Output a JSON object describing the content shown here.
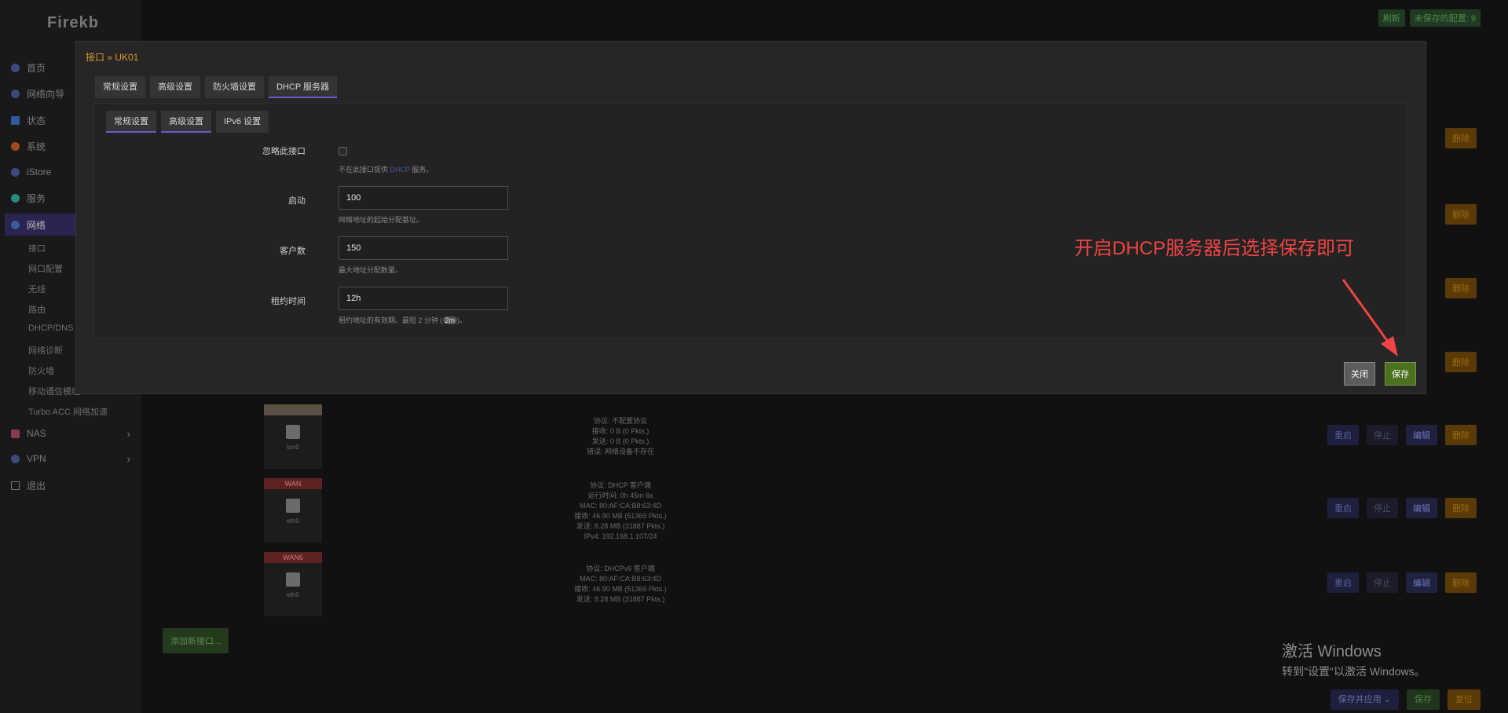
{
  "brand": "Firekb",
  "sidebar": {
    "items": [
      {
        "label": "首页",
        "color": "#3b4a7c"
      },
      {
        "label": "网络向导",
        "color": "#3b4a7c"
      },
      {
        "label": "状态",
        "color": "#2f5a9c"
      },
      {
        "label": "系统",
        "color": "#a34a1a"
      },
      {
        "label": "iStore",
        "color": "#3b4a7c"
      },
      {
        "label": "服务",
        "color": "#2a8a7a"
      },
      {
        "label": "网络",
        "color": "#3b5a9c"
      }
    ],
    "subitems": [
      "接口",
      "网口配置",
      "无线",
      "路由",
      "DHCP/DNS",
      "网络诊断",
      "防火墙",
      "移动通信模组",
      "Turbo ACC 网络加速"
    ],
    "bottom_items": [
      "NAS",
      "VPN",
      "退出"
    ]
  },
  "top_buttons": {
    "refresh": "刷新",
    "unsaved": "未保存的配置: 9"
  },
  "row_buttons": {
    "restart": "重启",
    "stop": "停止",
    "edit": "编辑",
    "delete": "删除"
  },
  "interfaces": [
    {
      "name": "",
      "device": "tun0",
      "info": [
        "协议: 不配置协议",
        "接收: 0 B (0 Pkts.)",
        "发送: 0 B (0 Pkts.)",
        "错误: 网络设备不存在"
      ]
    },
    {
      "name": "WAN",
      "device": "eth0",
      "info": [
        "协议: DHCP 客户端",
        "运行时间: 0h 45m 6s",
        "MAC: 80:AF:CA:B8:63:4D",
        "接收: 46.90 MB (51369 Pkts.)",
        "发送: 8.28 MB (31887 Pkts.)",
        "IPv4: 192.168.1.107/24"
      ]
    },
    {
      "name": "WAN6",
      "device": "eth0",
      "info": [
        "协议: DHCPv6 客户端",
        "MAC: 80:AF:CA:B8:63:4D",
        "接收: 46.90 MB (51369 Pkts.)",
        "发送: 8.28 MB (31887 Pkts.)"
      ]
    }
  ],
  "add_interface": "添加新接口...",
  "watermark": {
    "line1": "激活 Windows",
    "line2": "转到\"设置\"以激活 Windows。"
  },
  "bottom_bar": {
    "apply": "保存并应用",
    "save": "保存",
    "reset": "复位"
  },
  "modal": {
    "title": "接口 » UK01",
    "tabs": [
      "常规设置",
      "高级设置",
      "防火墙设置",
      "DHCP 服务器"
    ],
    "subtabs": [
      "常规设置",
      "高级设置",
      "IPv6 设置"
    ],
    "fields": {
      "ignore": {
        "label": "忽略此接口",
        "desc_pre": "不在此接口提供 ",
        "desc_link": "DHCP",
        "desc_post": " 服务。"
      },
      "start": {
        "label": "启动",
        "value": "100",
        "desc": "网络地址的起始分配基址。"
      },
      "limit": {
        "label": "客户数",
        "value": "150",
        "desc": "最大地址分配数量。"
      },
      "lease": {
        "label": "租约时间",
        "value": "12h",
        "desc_pre": "租约地址的有效期。最短 2 分钟 (",
        "desc_pill": "2m",
        "desc_post": ")。"
      }
    },
    "close": "关闭",
    "save": "保存"
  },
  "annotation": "开启DHCP服务器后选择保存即可",
  "colors": {
    "accent": "#6a5acd",
    "annotation": "#f04343",
    "title": "#d79b2d"
  }
}
